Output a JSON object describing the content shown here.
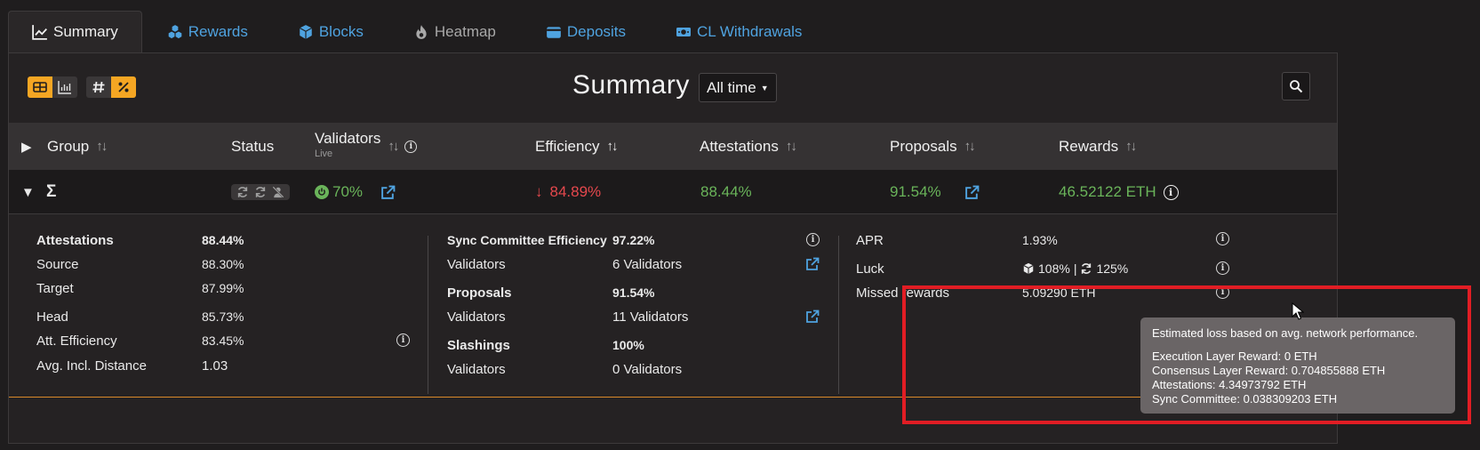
{
  "tabs": [
    {
      "label": "Summary",
      "icon": "chart-line-icon"
    },
    {
      "label": "Rewards",
      "icon": "cubes-icon"
    },
    {
      "label": "Blocks",
      "icon": "cube-icon"
    },
    {
      "label": "Heatmap",
      "icon": "fire-icon"
    },
    {
      "label": "Deposits",
      "icon": "wallet-icon"
    },
    {
      "label": "CL Withdrawals",
      "icon": "money-bill-icon"
    }
  ],
  "toolbar": {
    "title": "Summary",
    "time_filter": "All time"
  },
  "colors": {
    "accent": "#f5a623",
    "link": "#4fa3e0",
    "positive": "#6ab45a",
    "negative": "#e5484d",
    "highlight": "#e11d24"
  },
  "columns": {
    "group": "Group",
    "status": "Status",
    "validators": "Validators",
    "validators_sub": "Live",
    "efficiency": "Efficiency",
    "attestations": "Attestations",
    "proposals": "Proposals",
    "rewards": "Rewards"
  },
  "total_row": {
    "group": "Σ",
    "validators_pct": "70%",
    "efficiency": "84.89%",
    "attestations": "88.44%",
    "proposals": "91.54%",
    "rewards": "46.52122 ETH"
  },
  "details": {
    "col1": [
      {
        "label": "Attestations",
        "value": "88.44%"
      },
      {
        "label": "Source",
        "value": "88.30%"
      },
      {
        "label": "Target",
        "value": "87.99%"
      },
      {
        "label": "Head",
        "value": "85.73%"
      },
      {
        "label": "Att. Efficiency",
        "value": "83.45%"
      },
      {
        "label": "Avg. Incl. Distance",
        "value": "1.03"
      }
    ],
    "col2": [
      {
        "label": "Sync Committee Efficiency",
        "value": "97.22%"
      },
      {
        "label": "Validators",
        "value": "6 Validators"
      },
      {
        "label": "Proposals",
        "value": "91.54%"
      },
      {
        "label": "Validators",
        "value": "11 Validators"
      },
      {
        "label": "Slashings",
        "value": "100%"
      },
      {
        "label": "Validators",
        "value": "0 Validators"
      }
    ],
    "col3": {
      "apr_label": "APR",
      "apr_value": "1.93%",
      "luck_label": "Luck",
      "luck_blocks": "108%",
      "luck_sep": "|",
      "luck_sync": "125%",
      "missed_label": "Missed rewards",
      "missed_value": "5.09290 ETH"
    }
  },
  "tooltip": {
    "heading": "Estimated loss based on avg. network performance.",
    "lines": [
      "Execution Layer Reward: 0 ETH",
      "Consensus Layer Reward: 0.704855888 ETH",
      "Attestations: 4.34973792 ETH",
      "Sync Committee: 0.038309203 ETH"
    ]
  }
}
